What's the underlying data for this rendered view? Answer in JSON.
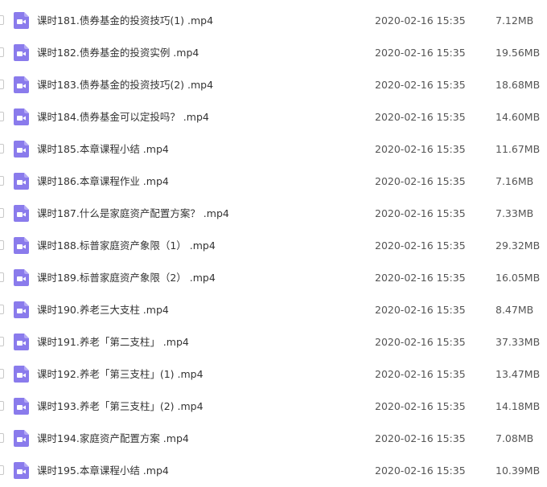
{
  "icon_colors": {
    "fill": "#8a7bec",
    "corner": "#b3a8f5",
    "glyph": "#ffffff"
  },
  "files": [
    {
      "name": "课时181.债券基金的投资技巧(1) .mp4",
      "date": "2020-02-16 15:35",
      "size": "7.12MB",
      "icon": "video-file-icon"
    },
    {
      "name": "课时182.债券基金的投资实例 .mp4",
      "date": "2020-02-16 15:35",
      "size": "19.56MB",
      "icon": "video-file-icon"
    },
    {
      "name": "课时183.债券基金的投资技巧(2) .mp4",
      "date": "2020-02-16 15:35",
      "size": "18.68MB",
      "icon": "video-file-icon"
    },
    {
      "name": "课时184.债券基金可以定投吗？ .mp4",
      "date": "2020-02-16 15:35",
      "size": "14.60MB",
      "icon": "video-file-icon"
    },
    {
      "name": "课时185.本章课程小结 .mp4",
      "date": "2020-02-16 15:35",
      "size": "11.67MB",
      "icon": "video-file-icon"
    },
    {
      "name": "课时186.本章课程作业 .mp4",
      "date": "2020-02-16 15:35",
      "size": "7.16MB",
      "icon": "video-file-icon"
    },
    {
      "name": "课时187.什么是家庭资产配置方案？ .mp4",
      "date": "2020-02-16 15:35",
      "size": "7.33MB",
      "icon": "video-file-icon"
    },
    {
      "name": "课时188.标普家庭资产象限（1） .mp4",
      "date": "2020-02-16 15:35",
      "size": "29.32MB",
      "icon": "video-file-icon"
    },
    {
      "name": "课时189.标普家庭资产象限（2） .mp4",
      "date": "2020-02-16 15:35",
      "size": "16.05MB",
      "icon": "video-file-icon"
    },
    {
      "name": "课时190.养老三大支柱 .mp4",
      "date": "2020-02-16 15:35",
      "size": "8.47MB",
      "icon": "video-file-icon"
    },
    {
      "name": "课时191.养老「第二支柱」 .mp4",
      "date": "2020-02-16 15:35",
      "size": "37.33MB",
      "icon": "video-file-icon"
    },
    {
      "name": "课时192.养老「第三支柱」(1) .mp4",
      "date": "2020-02-16 15:35",
      "size": "13.47MB",
      "icon": "video-file-icon"
    },
    {
      "name": "课时193.养老「第三支柱」(2) .mp4",
      "date": "2020-02-16 15:35",
      "size": "14.18MB",
      "icon": "video-file-icon"
    },
    {
      "name": "课时194.家庭资产配置方案 .mp4",
      "date": "2020-02-16 15:35",
      "size": "7.08MB",
      "icon": "video-file-icon"
    },
    {
      "name": "课时195.本章课程小结 .mp4",
      "date": "2020-02-16 15:35",
      "size": "10.39MB",
      "icon": "video-file-icon"
    }
  ]
}
